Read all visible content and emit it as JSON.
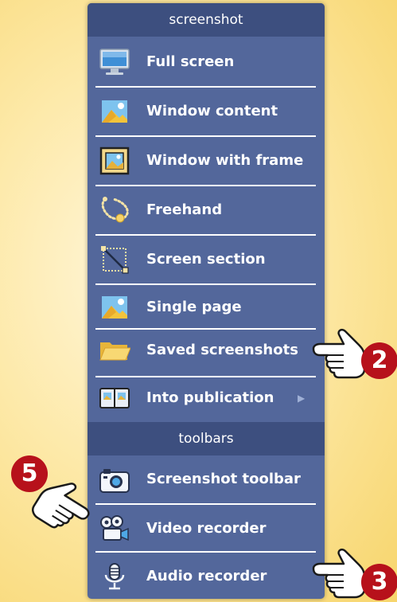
{
  "menu": {
    "section_screenshot": "screenshot",
    "section_toolbars": "toolbars",
    "items": [
      {
        "label": "Full screen"
      },
      {
        "label": "Window content"
      },
      {
        "label": "Window with frame"
      },
      {
        "label": "Freehand"
      },
      {
        "label": "Screen section"
      },
      {
        "label": "Single page"
      },
      {
        "label": "Saved screenshots"
      },
      {
        "label": "Into publication",
        "arrow": "▶"
      },
      {
        "label": "Screenshot toolbar"
      },
      {
        "label": "Video recorder"
      },
      {
        "label": "Audio recorder"
      }
    ]
  },
  "callouts": {
    "saved_screenshots_number": "2",
    "audio_recorder_number": "3",
    "screenshot_toolbar_number": "5"
  },
  "colors": {
    "menu_background": "#53679b",
    "header_background": "#3d4f7f",
    "badge": "#b7111b"
  }
}
